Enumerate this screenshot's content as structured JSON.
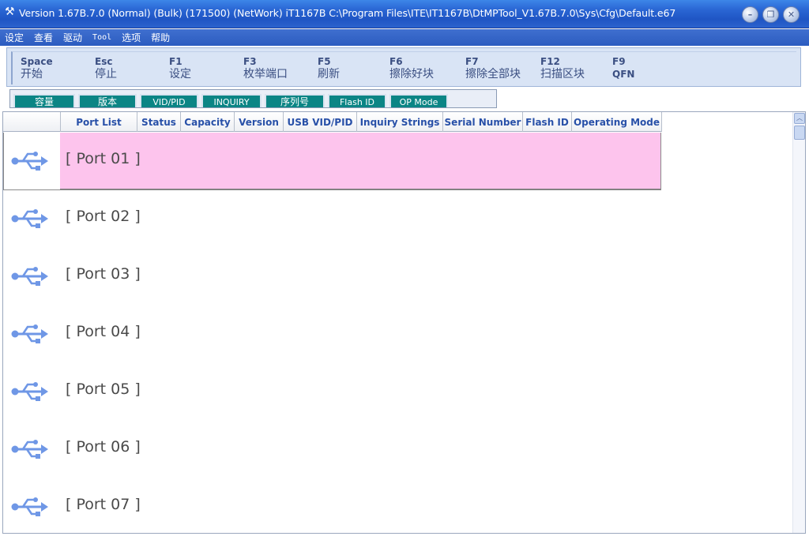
{
  "window": {
    "title": "Version 1.67B.7.0 (Normal) (Bulk) (171500) (NetWork) iT1167B C:\\Program Files\\ITE\\IT1167B\\DtMPTool_V1.67B.7.0\\Sys\\Cfg\\Default.e67",
    "app_icon": "tools-icon"
  },
  "menu": [
    "设定",
    "查看",
    "驱动",
    "Tool",
    "选项",
    "帮助"
  ],
  "toolbar": [
    {
      "key": "Space",
      "label": "开始"
    },
    {
      "key": "Esc",
      "label": "停止"
    },
    {
      "key": "F1",
      "label": "设定"
    },
    {
      "key": "F3",
      "label": "枚举端口"
    },
    {
      "key": "F5",
      "label": "刷新"
    },
    {
      "key": "F6",
      "label": "擦除好块"
    },
    {
      "key": "F7",
      "label": "擦除全部块"
    },
    {
      "key": "F12",
      "label": "扫描区块"
    },
    {
      "key": "F9",
      "label": "QFN"
    }
  ],
  "tabs": [
    "容量",
    "版本",
    "VID/PID",
    "INQUIRY",
    "序列号",
    "Flash ID",
    "OP Mode"
  ],
  "columns": [
    "",
    "Port List",
    "Status",
    "Capacity",
    "Version",
    "USB VID/PID",
    "Inquiry Strings",
    "Serial Number",
    "Flash ID",
    "Operating Mode"
  ],
  "ports": [
    {
      "label": "[ Port 01 ]",
      "selected": true
    },
    {
      "label": "[ Port 02 ]",
      "selected": false
    },
    {
      "label": "[ Port 03 ]",
      "selected": false
    },
    {
      "label": "[ Port 04 ]",
      "selected": false
    },
    {
      "label": "[ Port 05 ]",
      "selected": false
    },
    {
      "label": "[ Port 06 ]",
      "selected": false
    },
    {
      "label": "[ Port 07 ]",
      "selected": false
    }
  ],
  "colors": {
    "selected_row": "#fdc4ed",
    "tab_button": "#0b8585",
    "header_text": "#2850a8",
    "usb_icon": "#6f97e6"
  },
  "row_icon": "usb-icon"
}
